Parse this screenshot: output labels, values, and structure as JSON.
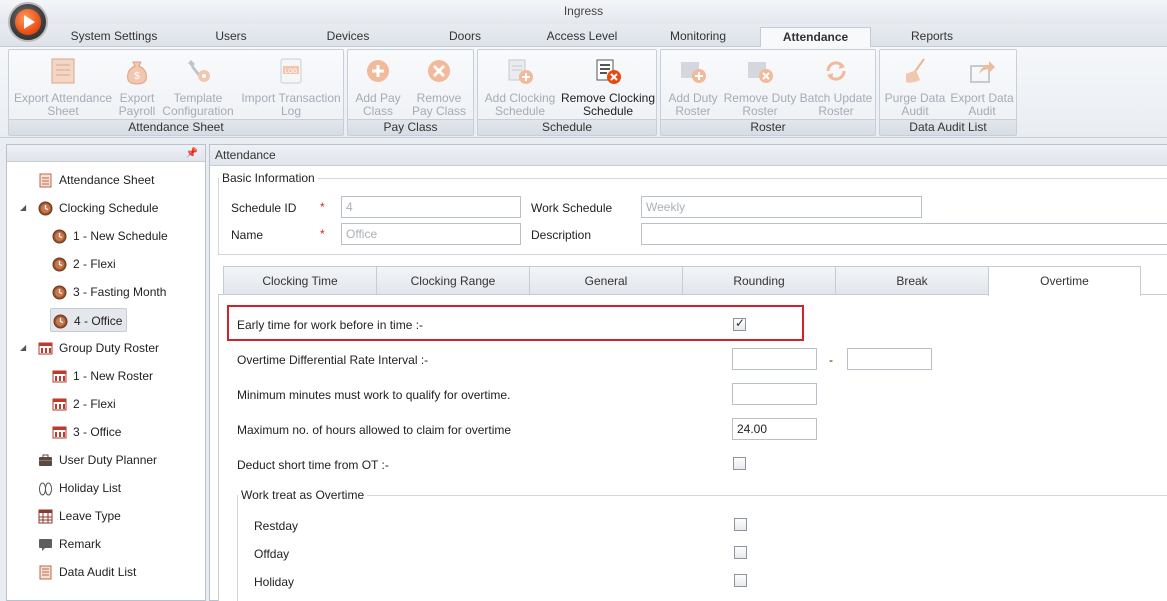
{
  "window": {
    "title": "Ingress"
  },
  "menu": {
    "tabs": [
      {
        "label": "System Settings",
        "active": false
      },
      {
        "label": "Users",
        "active": false
      },
      {
        "label": "Devices",
        "active": false
      },
      {
        "label": "Doors",
        "active": false
      },
      {
        "label": "Access Level",
        "active": false
      },
      {
        "label": "Monitoring",
        "active": false
      },
      {
        "label": "Attendance",
        "active": true
      },
      {
        "label": "Reports",
        "active": false
      }
    ]
  },
  "ribbon": {
    "groups": [
      {
        "label": "Attendance Sheet",
        "buttons": [
          {
            "label": "Export Attendance Sheet",
            "icon": "sheet-icon",
            "enabled": false
          },
          {
            "label": "Export Payroll",
            "icon": "money-bag-icon",
            "enabled": false
          },
          {
            "label": "Template Configuration",
            "icon": "tools-icon",
            "enabled": false
          },
          {
            "label": "Import Transaction Log",
            "icon": "log-file-icon",
            "enabled": false
          }
        ]
      },
      {
        "label": "Pay Class",
        "buttons": [
          {
            "label": "Add Pay Class",
            "icon": "add-circle-icon",
            "enabled": false
          },
          {
            "label": "Remove Pay Class",
            "icon": "remove-circle-icon",
            "enabled": false
          }
        ]
      },
      {
        "label": "Schedule",
        "buttons": [
          {
            "label": "Add Clocking Schedule",
            "icon": "add-schedule-icon",
            "enabled": false
          },
          {
            "label": "Remove Clocking Schedule",
            "icon": "remove-schedule-icon",
            "enabled": true
          }
        ]
      },
      {
        "label": "Roster",
        "buttons": [
          {
            "label": "Add Duty Roster",
            "icon": "add-roster-icon",
            "enabled": false
          },
          {
            "label": "Remove Duty Roster",
            "icon": "remove-roster-icon",
            "enabled": false
          },
          {
            "label": "Batch Update Roster",
            "icon": "refresh-icon",
            "enabled": false
          }
        ]
      },
      {
        "label": "Data Audit List",
        "buttons": [
          {
            "label": "Purge Data Audit",
            "icon": "broom-icon",
            "enabled": false
          },
          {
            "label": "Export Data Audit",
            "icon": "export-icon",
            "enabled": false
          }
        ]
      }
    ]
  },
  "tree": {
    "items": [
      {
        "label": "Attendance Sheet",
        "icon": "sheet-icon",
        "level": 0,
        "expander": "",
        "selected": false
      },
      {
        "label": "Clocking Schedule",
        "icon": "clock-icon",
        "level": 0,
        "expander": "◢",
        "selected": false
      },
      {
        "label": "1 - New Schedule",
        "icon": "clock-icon",
        "level": 1,
        "expander": "",
        "selected": false
      },
      {
        "label": "2 - Flexi",
        "icon": "clock-icon",
        "level": 1,
        "expander": "",
        "selected": false
      },
      {
        "label": "3 - Fasting Month",
        "icon": "clock-icon",
        "level": 1,
        "expander": "",
        "selected": false
      },
      {
        "label": "4 - Office",
        "icon": "clock-icon",
        "level": 1,
        "expander": "",
        "selected": true
      },
      {
        "label": "Group Duty Roster",
        "icon": "roster-icon",
        "level": 0,
        "expander": "◢",
        "selected": false
      },
      {
        "label": "1 - New Roster",
        "icon": "roster-icon",
        "level": 1,
        "expander": "",
        "selected": false
      },
      {
        "label": "2 - Flexi",
        "icon": "roster-icon",
        "level": 1,
        "expander": "",
        "selected": false
      },
      {
        "label": "3 - Office",
        "icon": "roster-icon",
        "level": 1,
        "expander": "",
        "selected": false
      },
      {
        "label": "User Duty Planner",
        "icon": "briefcase-icon",
        "level": 0,
        "expander": "",
        "selected": false
      },
      {
        "label": "Holiday List",
        "icon": "sandals-icon",
        "level": 0,
        "expander": "",
        "selected": false
      },
      {
        "label": "Leave Type",
        "icon": "grid-icon",
        "level": 0,
        "expander": "",
        "selected": false
      },
      {
        "label": "Remark",
        "icon": "comment-icon",
        "level": 0,
        "expander": "",
        "selected": false
      },
      {
        "label": "Data Audit List",
        "icon": "list-icon",
        "level": 0,
        "expander": "",
        "selected": false
      }
    ]
  },
  "main": {
    "header": "Attendance",
    "basic_info": {
      "legend": "Basic Information",
      "schedule_id_label": "Schedule ID",
      "schedule_id_value": "4",
      "name_label": "Name",
      "name_value": "Office",
      "required_mark": "*",
      "work_schedule_label": "Work Schedule",
      "work_schedule_value": "Weekly",
      "description_label": "Description",
      "description_value": ""
    },
    "tabs": [
      {
        "label": "Clocking Time",
        "active": false
      },
      {
        "label": "Clocking Range",
        "active": false
      },
      {
        "label": "General",
        "active": false
      },
      {
        "label": "Rounding",
        "active": false
      },
      {
        "label": "Break",
        "active": false
      },
      {
        "label": "Overtime",
        "active": true
      }
    ],
    "overtime": {
      "early_time_label": "Early time for work before in time :-",
      "early_time_checked": true,
      "differential_label": "Overtime Differential Rate Interval :-",
      "differential_from": "",
      "differential_dash": "-",
      "differential_to": "",
      "min_minutes_label": "Minimum minutes must work to qualify for overtime.",
      "min_minutes_value": "",
      "max_hours_label": "Maximum no. of hours allowed to claim for overtime",
      "max_hours_value": "24.00",
      "deduct_label": "Deduct short time from OT :-",
      "deduct_checked": false,
      "work_treat_legend": "Work treat as Overtime",
      "restday_label": "Restday",
      "restday_checked": false,
      "offday_label": "Offday",
      "offday_checked": false,
      "holiday_label": "Holiday",
      "holiday_checked": false
    }
  },
  "colors": {
    "highlight": "#d3232a",
    "required": "#dd2233",
    "disabled_text": "#a6acb5",
    "accent_orange": "#e8490f"
  }
}
